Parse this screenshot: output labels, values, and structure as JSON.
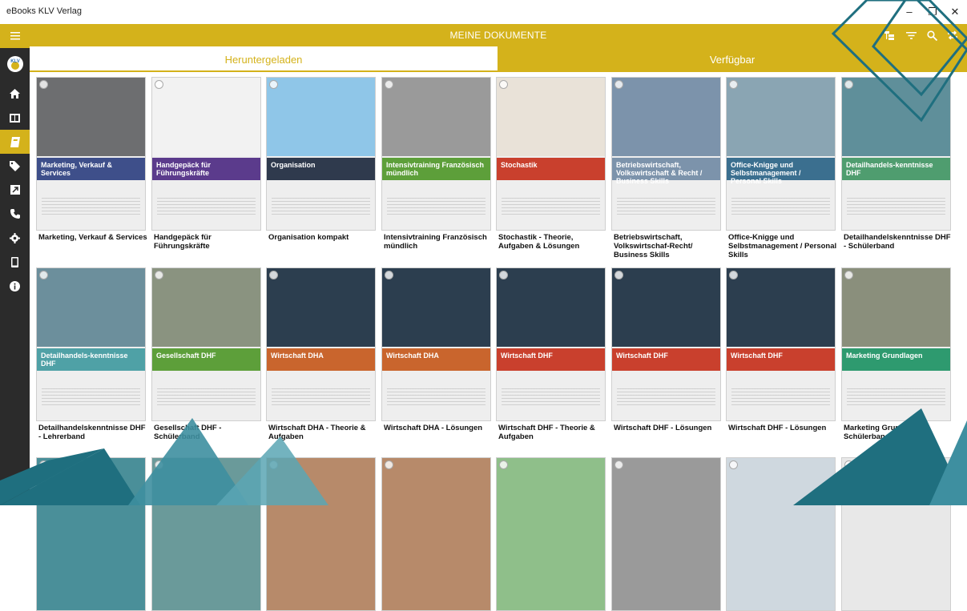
{
  "window": {
    "title": "eBooks KLV Verlag",
    "minimize": "–",
    "maximize": "❐",
    "close": "✕"
  },
  "appbar": {
    "title": "MEINE DOKUMENTE",
    "accent": "#d4b21b"
  },
  "tabs": [
    {
      "label": "Heruntergeladen",
      "active": true
    },
    {
      "label": "Verfügbar",
      "active": false
    }
  ],
  "sidebar": {
    "items": [
      {
        "name": "menu",
        "icon": "hamburger-icon"
      },
      {
        "name": "logo",
        "icon": "klv-logo"
      },
      {
        "name": "home",
        "icon": "home-icon"
      },
      {
        "name": "library",
        "icon": "book-open-icon"
      },
      {
        "name": "documents",
        "icon": "book-icon",
        "active": true
      },
      {
        "name": "tags",
        "icon": "tag-icon"
      },
      {
        "name": "external",
        "icon": "external-link-icon"
      },
      {
        "name": "phone",
        "icon": "phone-icon"
      },
      {
        "name": "settings",
        "icon": "gear-icon"
      },
      {
        "name": "device",
        "icon": "device-icon"
      },
      {
        "name": "info",
        "icon": "info-icon"
      }
    ]
  },
  "books": [
    {
      "title": "Marketing, Verkauf & Services",
      "cover_text": "Marketing, Verkauf & Services",
      "photo": "#6d6e70",
      "band": "#3e4f8a"
    },
    {
      "title": "Handgepäck für Führungskräfte",
      "cover_text": "Handgepäck für Führungskräfte",
      "photo": "#f2f2f2",
      "band": "#5b3b8c"
    },
    {
      "title": "Organisation kompakt",
      "cover_text": "Organisation",
      "photo": "#8fc6e8",
      "band": "#2f3a4d"
    },
    {
      "title": "Intensivtraining Französisch mündlich",
      "cover_text": "Intensivtraining Französisch mündlich",
      "photo": "#9a9a9a",
      "band": "#5d9f3a"
    },
    {
      "title": "Stochastik - Theorie, Aufgaben & Lösungen",
      "cover_text": "Stochastik",
      "photo": "#e9e2d8",
      "band": "#c9402d"
    },
    {
      "title": "Betriebswirtschaft, Volkswirtschaf-Recht/ Business Skills",
      "cover_text": "Betriebswirtschaft, Volkswirtschaft & Recht / Business Skills",
      "photo": "#7c93ab",
      "band": "#7c93ab"
    },
    {
      "title": "Office-Knigge und Selbstmanagement / Personal Skills",
      "cover_text": "Office-Knigge und Selbstmanagement / Personal Skills",
      "photo": "#8aa5b3",
      "band": "#3b6f8f"
    },
    {
      "title": "Detailhandelskenntnisse DHF - Schülerband",
      "cover_text": "Detailhandels-kenntnisse DHF",
      "photo": "#5f8f9a",
      "band": "#4f9d6f"
    },
    {
      "title": "Detailhandelskenntnisse DHF - Lehrerband",
      "cover_text": "Detailhandels-kenntnisse DHF",
      "photo": "#6c8f9c",
      "band": "#4fa1a6"
    },
    {
      "title": "Gesellschaft DHF - Schülerband",
      "cover_text": "Gesellschaft DHF",
      "photo": "#8a9380",
      "band": "#5d9f3a"
    },
    {
      "title": "Wirtschaft DHA - Theorie & Aufgaben",
      "cover_text": "Wirtschaft DHA",
      "photo": "#2c3e4f",
      "band": "#c9652d"
    },
    {
      "title": "Wirtschaft DHA - Lösungen",
      "cover_text": "Wirtschaft DHA",
      "photo": "#2c3e4f",
      "band": "#c9652d"
    },
    {
      "title": "Wirtschaft DHF - Theorie & Aufgaben",
      "cover_text": "Wirtschaft DHF",
      "photo": "#2c3e4f",
      "band": "#c9402d"
    },
    {
      "title": "Wirtschaft DHF - Lösungen",
      "cover_text": "Wirtschaft DHF",
      "photo": "#2c3e4f",
      "band": "#c9402d"
    },
    {
      "title": "Wirtschaft DHF - Lösungen",
      "cover_text": "Wirtschaft DHF",
      "photo": "#2c3e4f",
      "band": "#c9402d"
    },
    {
      "title": "Marketing Grundlagen - Schülerband",
      "cover_text": "Marketing Grundlagen",
      "photo": "#8a8f7c",
      "band": "#2e9a6f"
    },
    {
      "title": "",
      "cover_text": "",
      "photo": "#4a8f99",
      "band": "#4a8f99"
    },
    {
      "title": "",
      "cover_text": "",
      "photo": "#6a9a9a",
      "band": "#6a9a9a"
    },
    {
      "title": "",
      "cover_text": "",
      "photo": "#b78a6a",
      "band": "#b78a6a"
    },
    {
      "title": "",
      "cover_text": "",
      "photo": "#b78a6a",
      "band": "#b78a6a"
    },
    {
      "title": "",
      "cover_text": "",
      "photo": "#8fbf8a",
      "band": "#8fbf8a"
    },
    {
      "title": "",
      "cover_text": "",
      "photo": "#9a9a9a",
      "band": "#9a9a9a"
    },
    {
      "title": "",
      "cover_text": "",
      "photo": "#cfd8df",
      "band": "#cfd8df"
    },
    {
      "title": "",
      "cover_text": "",
      "photo": "#e8e8e8",
      "band": "#e8e8e8"
    }
  ]
}
